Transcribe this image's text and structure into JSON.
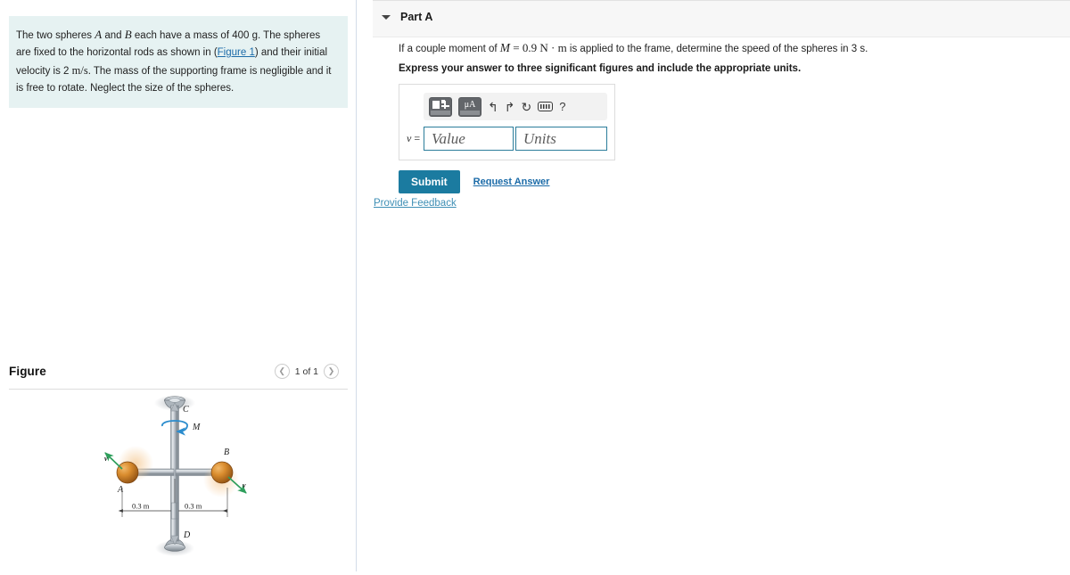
{
  "problem": {
    "text_part1": "The two spheres ",
    "sphere_a": "A",
    "text_part2": " and ",
    "sphere_b": "B",
    "text_part3": " each have a mass of 400 g. The spheres are fixed to the horizontal rods as shown in (",
    "figure_link": "Figure 1",
    "text_part4": ") and their initial velocity is 2 ",
    "unit_ms": "m/s",
    "text_part5": ". The mass of the supporting frame is negligible and it is free to rotate. Neglect the size of the spheres.",
    "background_color": "#e6f2f2"
  },
  "figure": {
    "title": "Figure",
    "pager_label": "1 of 1",
    "prev_icon": "chevron-left-icon",
    "next_icon": "chevron-right-icon",
    "labels": {
      "bearing_top": "C",
      "bearing_bottom": "D",
      "sphere_a": "A",
      "sphere_b": "B",
      "moment": "M",
      "velocity_left": "v",
      "velocity_right": "v",
      "dim_left": "0.3 m",
      "dim_right": "0.3 m"
    },
    "colors": {
      "sphere": "#c87a28",
      "rod": "#9aa3ab",
      "moment_arrow": "#2b8ccd",
      "velocity_arrow": "#2e9e5b"
    }
  },
  "part_a": {
    "caret_icon": "chevron-down-icon",
    "title": "Part A",
    "question_pre": "If a couple moment of ",
    "question_var": "M",
    "question_eq": " = 0.9 ",
    "question_unit": "N · m",
    "question_post": " is applied to the frame, determine the speed of the spheres in 3 s.",
    "instruction": "Express your answer to three significant figures and include the appropriate units.",
    "answer": {
      "variable_label": "v",
      "equals": "=",
      "value_placeholder": "Value",
      "units_placeholder": "Units",
      "value": "",
      "units": "",
      "border_color": "#2b7d9b"
    },
    "toolbar": {
      "template_icon": "math-template-icon",
      "units_icon": "micro-amp-units-icon",
      "units_text": "μA",
      "undo_icon": "undo-arrow-icon",
      "undo_glyph": "⬅",
      "redo_icon": "redo-arrow-icon",
      "redo_glyph": "➡",
      "reset_icon": "reset-circular-arrow-icon",
      "reset_glyph": "↻",
      "keyboard_icon": "keyboard-icon",
      "help_icon": "help-question-icon",
      "help_glyph": "?"
    },
    "submit_label": "Submit",
    "request_answer_label": "Request Answer",
    "submit_color": "#1b7ba0"
  },
  "footer": {
    "provide_feedback": "Provide Feedback"
  }
}
